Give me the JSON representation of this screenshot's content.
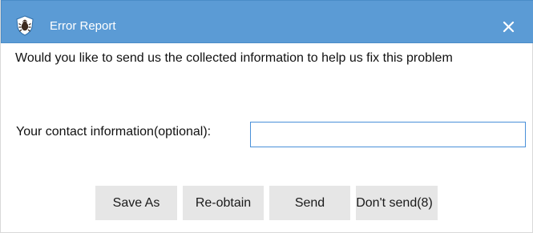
{
  "window": {
    "title": "Error Report",
    "icon": "bug-shield-icon",
    "close_icon": "close-icon",
    "titlebar_color": "#5b9bd5"
  },
  "message": "Would you like to send us the collected information to help us fix this problem",
  "contact": {
    "label": "Your contact information(optional):",
    "value": "",
    "placeholder": ""
  },
  "buttons": {
    "save_as": "Save As",
    "reobtain": "Re-obtain",
    "send": "Send",
    "dont_send": "Don't send(8)"
  }
}
